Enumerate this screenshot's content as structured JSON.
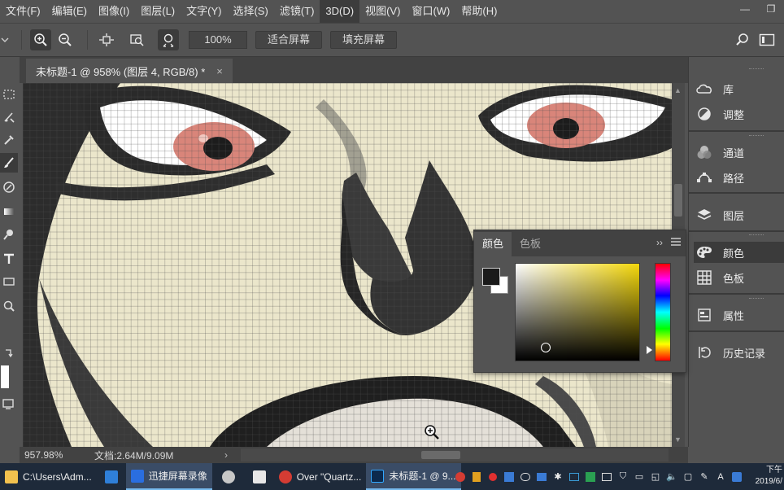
{
  "menu": [
    "文件(F)",
    "编辑(E)",
    "图像(I)",
    "图层(L)",
    "文字(Y)",
    "选择(S)",
    "滤镜(T)",
    "3D(D)",
    "视图(V)",
    "窗口(W)",
    "帮助(H)"
  ],
  "options": {
    "zoom_value": "100%",
    "fit_screen": "适合屏幕",
    "fill_screen": "填充屏幕"
  },
  "document": {
    "tab_title": "未标题-1 @ 958% (图层 4, RGB/8) *",
    "close": "×"
  },
  "status": {
    "zoom": "957.98%",
    "doc_size": "文档:2.64M/9.09M",
    "arrow": "›"
  },
  "panels": {
    "library": "库",
    "adjustments": "调整",
    "channels": "通道",
    "paths": "路径",
    "layers": "图层",
    "color": "颜色",
    "swatches": "色板",
    "properties": "属性",
    "history": "历史记录"
  },
  "color_panel": {
    "tab_color": "颜色",
    "tab_swatches": "色板",
    "more": "››",
    "foreground_color": "#1a1a1a",
    "background_color": "#ffffff",
    "hue_color": "#f5d80b"
  },
  "taskbar": {
    "explorer": "C:\\Users\\Adm...",
    "recorder": "迅捷屏幕录像",
    "music": "Over \"Quartz...",
    "photoshop": "未标题-1 @ 9...",
    "ime": "A",
    "time": "下午",
    "date": "2019/6/"
  }
}
